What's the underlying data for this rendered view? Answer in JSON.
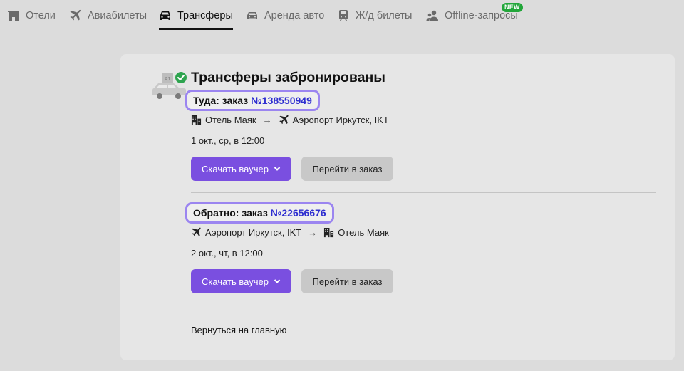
{
  "nav": {
    "items": [
      {
        "label": "Отели",
        "icon": "hotel-icon"
      },
      {
        "label": "Авиабилеты",
        "icon": "plane-icon"
      },
      {
        "label": "Трансферы",
        "icon": "car-icon",
        "active": true
      },
      {
        "label": "Аренда авто",
        "icon": "car-rental-icon"
      },
      {
        "label": "Ж/д билеты",
        "icon": "train-icon"
      },
      {
        "label": "Offline-запросы",
        "icon": "users-icon"
      }
    ],
    "new_badge": "NEW"
  },
  "card": {
    "title": "Трансферы забронированы",
    "outbound": {
      "order_prefix": "Туда: заказ",
      "order_number": "№138550949",
      "from": "Отель Маяк",
      "arrow": "→",
      "to": "Аэропорт Иркутск, IKT",
      "date": "1 окт., ср, в 12:00",
      "download_label": "Скачать ваучер",
      "goto_label": "Перейти в заказ"
    },
    "return": {
      "order_prefix": "Обратно: заказ",
      "order_number": "№22656676",
      "from": "Аэропорт Иркутск, IKT",
      "arrow": "→",
      "to": "Отель Маяк",
      "date": "2 окт., чт, в 12:00",
      "download_label": "Скачать ваучер",
      "goto_label": "Перейти в заказ"
    },
    "home_link": "Вернуться на главную"
  },
  "colors": {
    "accent": "#7a4fe0",
    "order_number": "#2f2fd0",
    "chip_border": "#9b85f0",
    "new_badge": "#22a63a",
    "success": "#2ea44f"
  }
}
